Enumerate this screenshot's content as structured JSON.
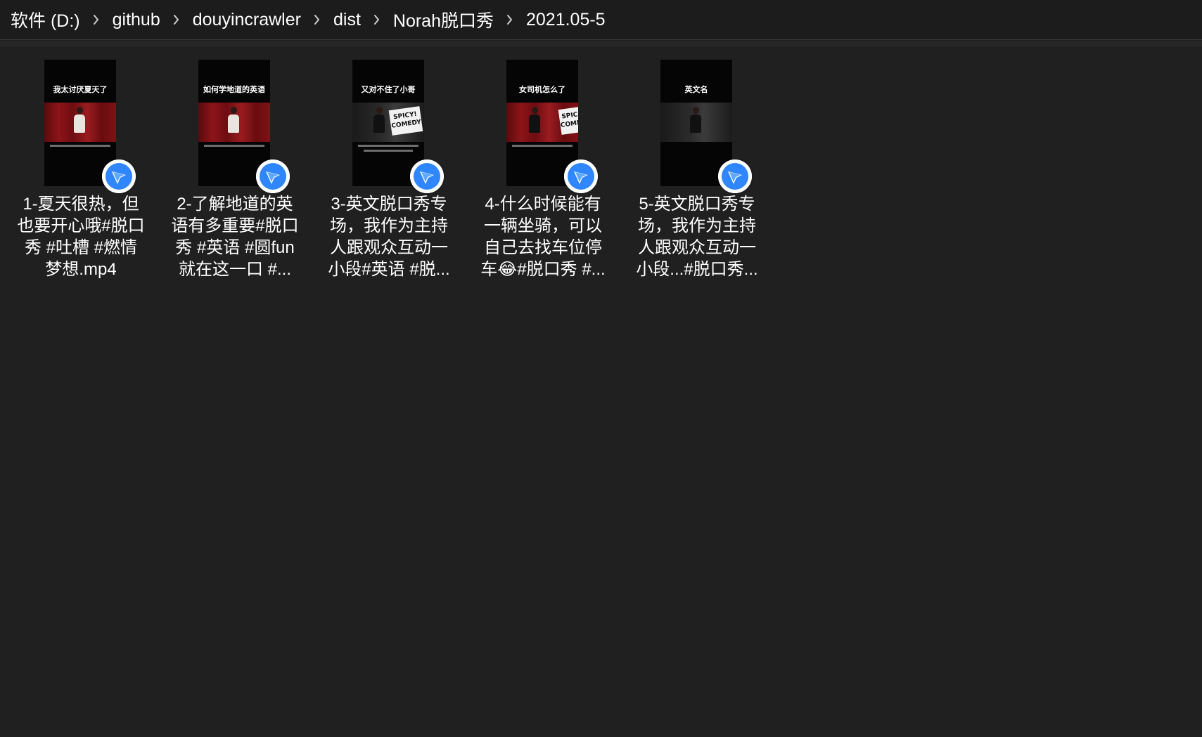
{
  "breadcrumb": {
    "items": [
      {
        "label": "软件 (D:)"
      },
      {
        "label": "github"
      },
      {
        "label": "douyincrawler"
      },
      {
        "label": "dist"
      },
      {
        "label": "Norah脱口秀"
      },
      {
        "label": "2021.05-5"
      }
    ],
    "separator_icon": "chevron-right-icon"
  },
  "files": [
    {
      "thumb_caption": "我太讨厌夏天了",
      "label_lines": [
        "1-夏天很热，但",
        "也要开心哦#脱口",
        "秀 #吐槽 #燃情",
        "梦想.mp4"
      ]
    },
    {
      "thumb_caption": "如何学地道的英语",
      "label_lines": [
        "2-了解地道的英",
        "语有多重要#脱口",
        "秀 #英语 #圆fun",
        "就在这一口 #..."
      ]
    },
    {
      "thumb_caption": "又对不住了小哥",
      "thumb_sign": "SPICY! COMEDY",
      "label_lines": [
        "3-英文脱口秀专",
        "场，我作为主持",
        "人跟观众互动一",
        "小段#英语 #脱..."
      ]
    },
    {
      "thumb_caption": "女司机怎么了",
      "thumb_sign": "SPIC COME",
      "label_lines": [
        "4-什么时候能有",
        "一辆坐骑，可以",
        "自己去找车位停",
        "车😂#脱口秀 #..."
      ]
    },
    {
      "thumb_caption": "英文名",
      "label_lines": [
        "5-英文脱口秀专",
        "场，我作为主持",
        "人跟观众互动一",
        "小段...#脱口秀..."
      ]
    }
  ],
  "icons": {
    "file_badge": "video-player-app-icon"
  },
  "colors": {
    "background": "#202020",
    "breadcrumb_bar": "#1c1c1c",
    "text": "#ffffff",
    "badge_blue": "#1e7bff"
  }
}
